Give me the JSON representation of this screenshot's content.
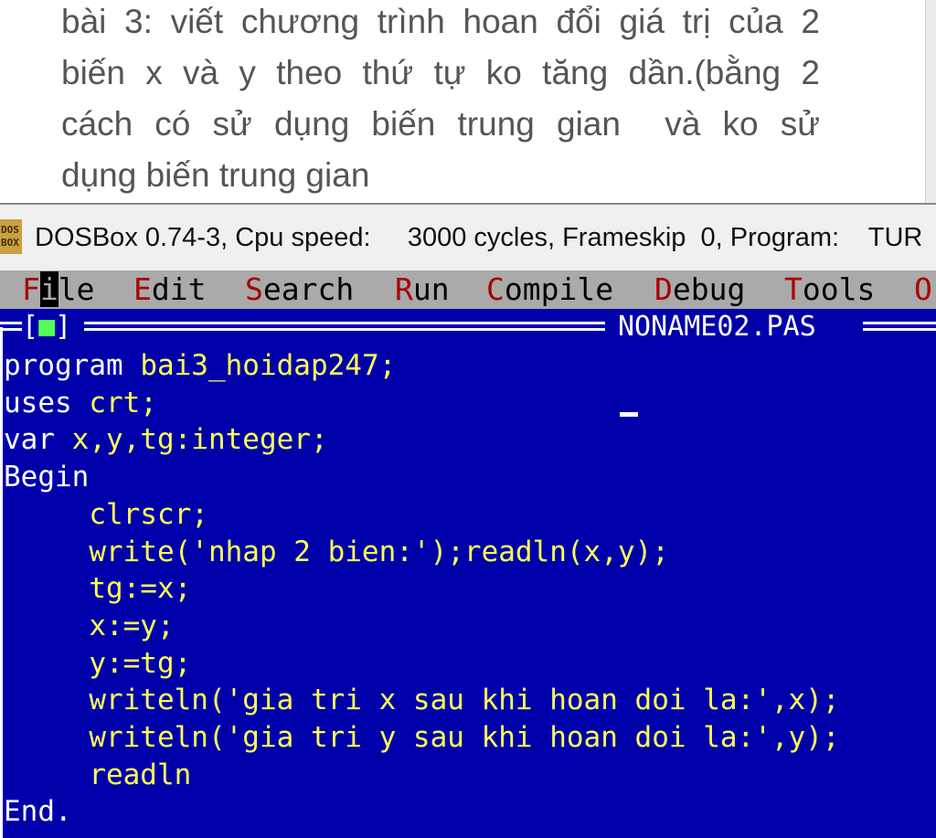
{
  "question": {
    "lines": [
      "bài 3: viết chương trình hoan đổi giá trị của 2",
      "biến x và y theo thứ tự ko tăng dần.(bằng 2",
      "cách có sử dụng biến trung gian  và ko sử",
      "dụng biến trung gian"
    ]
  },
  "window": {
    "icon_text_top": "DOS",
    "icon_text_bottom": "BOX",
    "title": "DOSBox 0.74-3, Cpu speed:     3000 cycles, Frameskip  0, Program:    TUR"
  },
  "menu": {
    "items": [
      {
        "hot": "F",
        "rest": "ile"
      },
      {
        "hot": "E",
        "rest": "dit"
      },
      {
        "hot": "S",
        "rest": "earch"
      },
      {
        "hot": "R",
        "rest": "un"
      },
      {
        "hot": "C",
        "rest": "ompile"
      },
      {
        "hot": "D",
        "rest": "ebug"
      },
      {
        "hot": "T",
        "rest": "ools"
      },
      {
        "hot": "O",
        "rest": ""
      }
    ]
  },
  "editor": {
    "window_control": "[■]",
    "filename": "NONAME02.PAS",
    "code": [
      {
        "kw": "program",
        "tx": " bai3_hoidap247;"
      },
      {
        "kw": "uses",
        "tx": " crt;"
      },
      {
        "kw": "var",
        "tx": " x,y,tg:integer;"
      },
      {
        "kw": "Begin",
        "tx": ""
      },
      {
        "kw": "",
        "tx": "     clrscr;"
      },
      {
        "kw": "",
        "tx": "     write('nhap 2 bien:');readln(x,y);"
      },
      {
        "kw": "",
        "tx": "     tg:=x;"
      },
      {
        "kw": "",
        "tx": "     x:=y;"
      },
      {
        "kw": "",
        "tx": "     y:=tg;"
      },
      {
        "kw": "",
        "tx": "     writeln('gia tri x sau khi hoan doi la:',x);"
      },
      {
        "kw": "",
        "tx": "     writeln('gia tri y sau khi hoan doi la:',y);"
      },
      {
        "kw": "",
        "tx": "     readln"
      },
      {
        "kw": "End",
        "tx": "."
      }
    ]
  },
  "colors": {
    "editor_bg": "#0000aa",
    "code_text": "#ffff55",
    "keyword": "#ffffff",
    "menu_bg": "#aaaaaa",
    "hotkey": "#aa0000"
  }
}
